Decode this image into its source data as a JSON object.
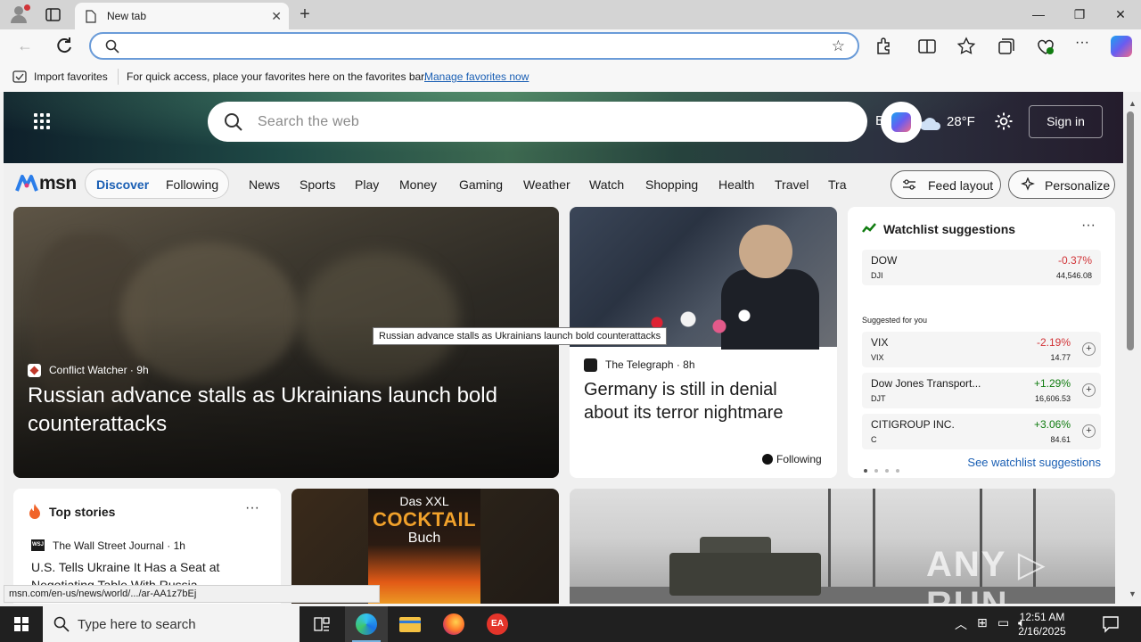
{
  "browser": {
    "tab_title": "New tab",
    "new_tab_symbol": "+",
    "close_tab_symbol": "✕",
    "address_placeholder": "",
    "window_controls": {
      "minimize": "—",
      "restore": "❐",
      "close": "✕"
    }
  },
  "favorites_bar": {
    "import_label": "Import favorites",
    "hint": "For quick access, place your favorites here on the favorites bar.",
    "manage_link": "Manage favorites now"
  },
  "msn": {
    "search_placeholder": "Search the web",
    "weather_city": "Berlin",
    "temperature": "28°F",
    "sign_in": "Sign in",
    "logo_text": "msn",
    "nav_pills": {
      "discover": "Discover",
      "following": "Following"
    },
    "categories": [
      "News",
      "Sports",
      "Play",
      "Money",
      "Gaming",
      "Weather",
      "Watch",
      "Shopping",
      "Health",
      "Travel",
      "Tra"
    ],
    "feed_layout": "Feed layout",
    "personalize": "Personalize"
  },
  "main_story": {
    "source": "Conflict Watcher",
    "age": "9h",
    "headline": "Russian advance stalls as Ukrainians launch bold counterattacks",
    "tooltip": "Russian advance stalls as Ukrainians launch bold counterattacks"
  },
  "telegraph_story": {
    "source": "The Telegraph",
    "age": "8h",
    "headline": "Germany is still in denial about its terror nightmare",
    "follow_label": "Following"
  },
  "watchlist": {
    "title": "Watchlist suggestions",
    "more": "···",
    "suggested_label": "Suggested for you",
    "see_all": "See watchlist suggestions",
    "colors": {
      "down": "#d13438",
      "up": "#107c10"
    },
    "stocks": [
      {
        "name": "DOW",
        "symbol": "DJI",
        "change": "-0.37%",
        "value": "44,546.08",
        "direction": "down"
      },
      {
        "name": "VIX",
        "symbol": "VIX",
        "change": "-2.19%",
        "value": "14.77",
        "direction": "down"
      },
      {
        "name": "Dow Jones Transport...",
        "symbol": "DJT",
        "change": "+1.29%",
        "value": "16,606.53",
        "direction": "up"
      },
      {
        "name": "CITIGROUP INC.",
        "symbol": "C",
        "change": "+3.06%",
        "value": "84.61",
        "direction": "up"
      }
    ]
  },
  "top_stories": {
    "title": "Top stories",
    "more": "···",
    "source_badge": "WSJ",
    "source": "The Wall Street Journal",
    "age": "1h",
    "headline": "U.S. Tells Ukraine It Has a Seat at Negotiating Table With Russia"
  },
  "promo": {
    "line1": "Das XXL",
    "line2": "COCKTAIL",
    "line3": "Buch"
  },
  "watermark": "ANY ▷ RUN",
  "status_url": "msn.com/en-us/news/world/.../ar-AA1z7bEj",
  "taskbar": {
    "search_placeholder": "Type here to search",
    "time": "12:51 AM",
    "date": "2/16/2025"
  }
}
